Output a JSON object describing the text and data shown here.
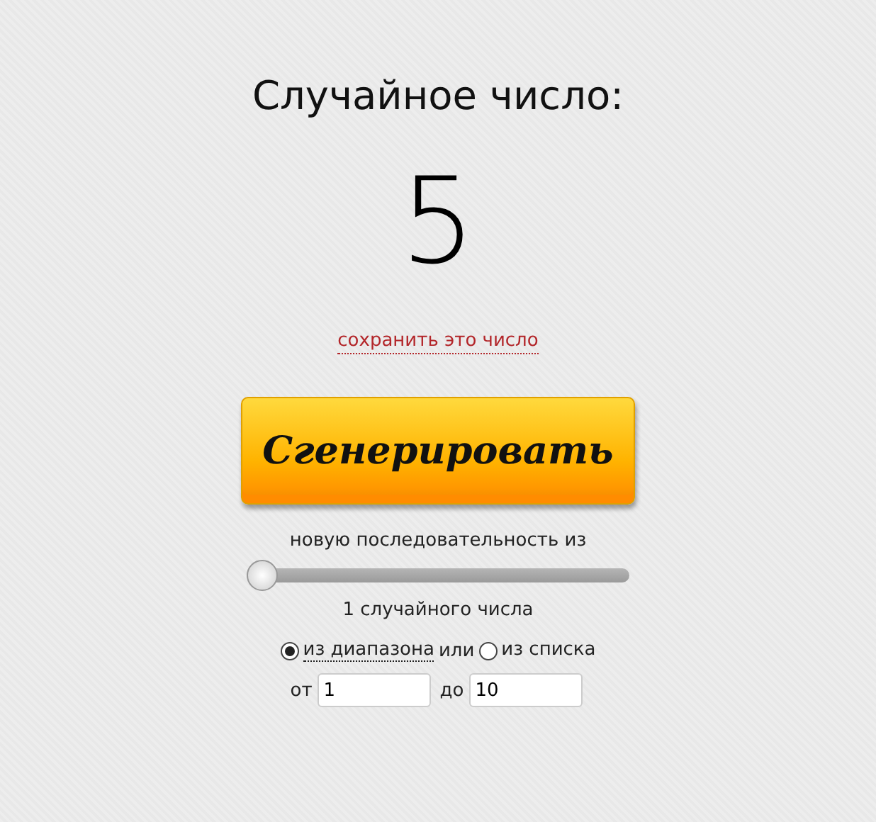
{
  "title": "Случайное число:",
  "result": "5",
  "save_link": "сохранить это число",
  "generate_button": "Сгенерировать",
  "sequence_label": "новую последовательность из",
  "count_slider": {
    "level": 0
  },
  "count_label": "1 случайного числа",
  "sources": [
    {
      "label": "из диапазона",
      "selected": true,
      "suffix": "или"
    },
    {
      "label": "из списка",
      "selected": false
    }
  ],
  "range": {
    "from_label": "от",
    "from_value": "1",
    "to_label": "до",
    "to_value": "10"
  }
}
